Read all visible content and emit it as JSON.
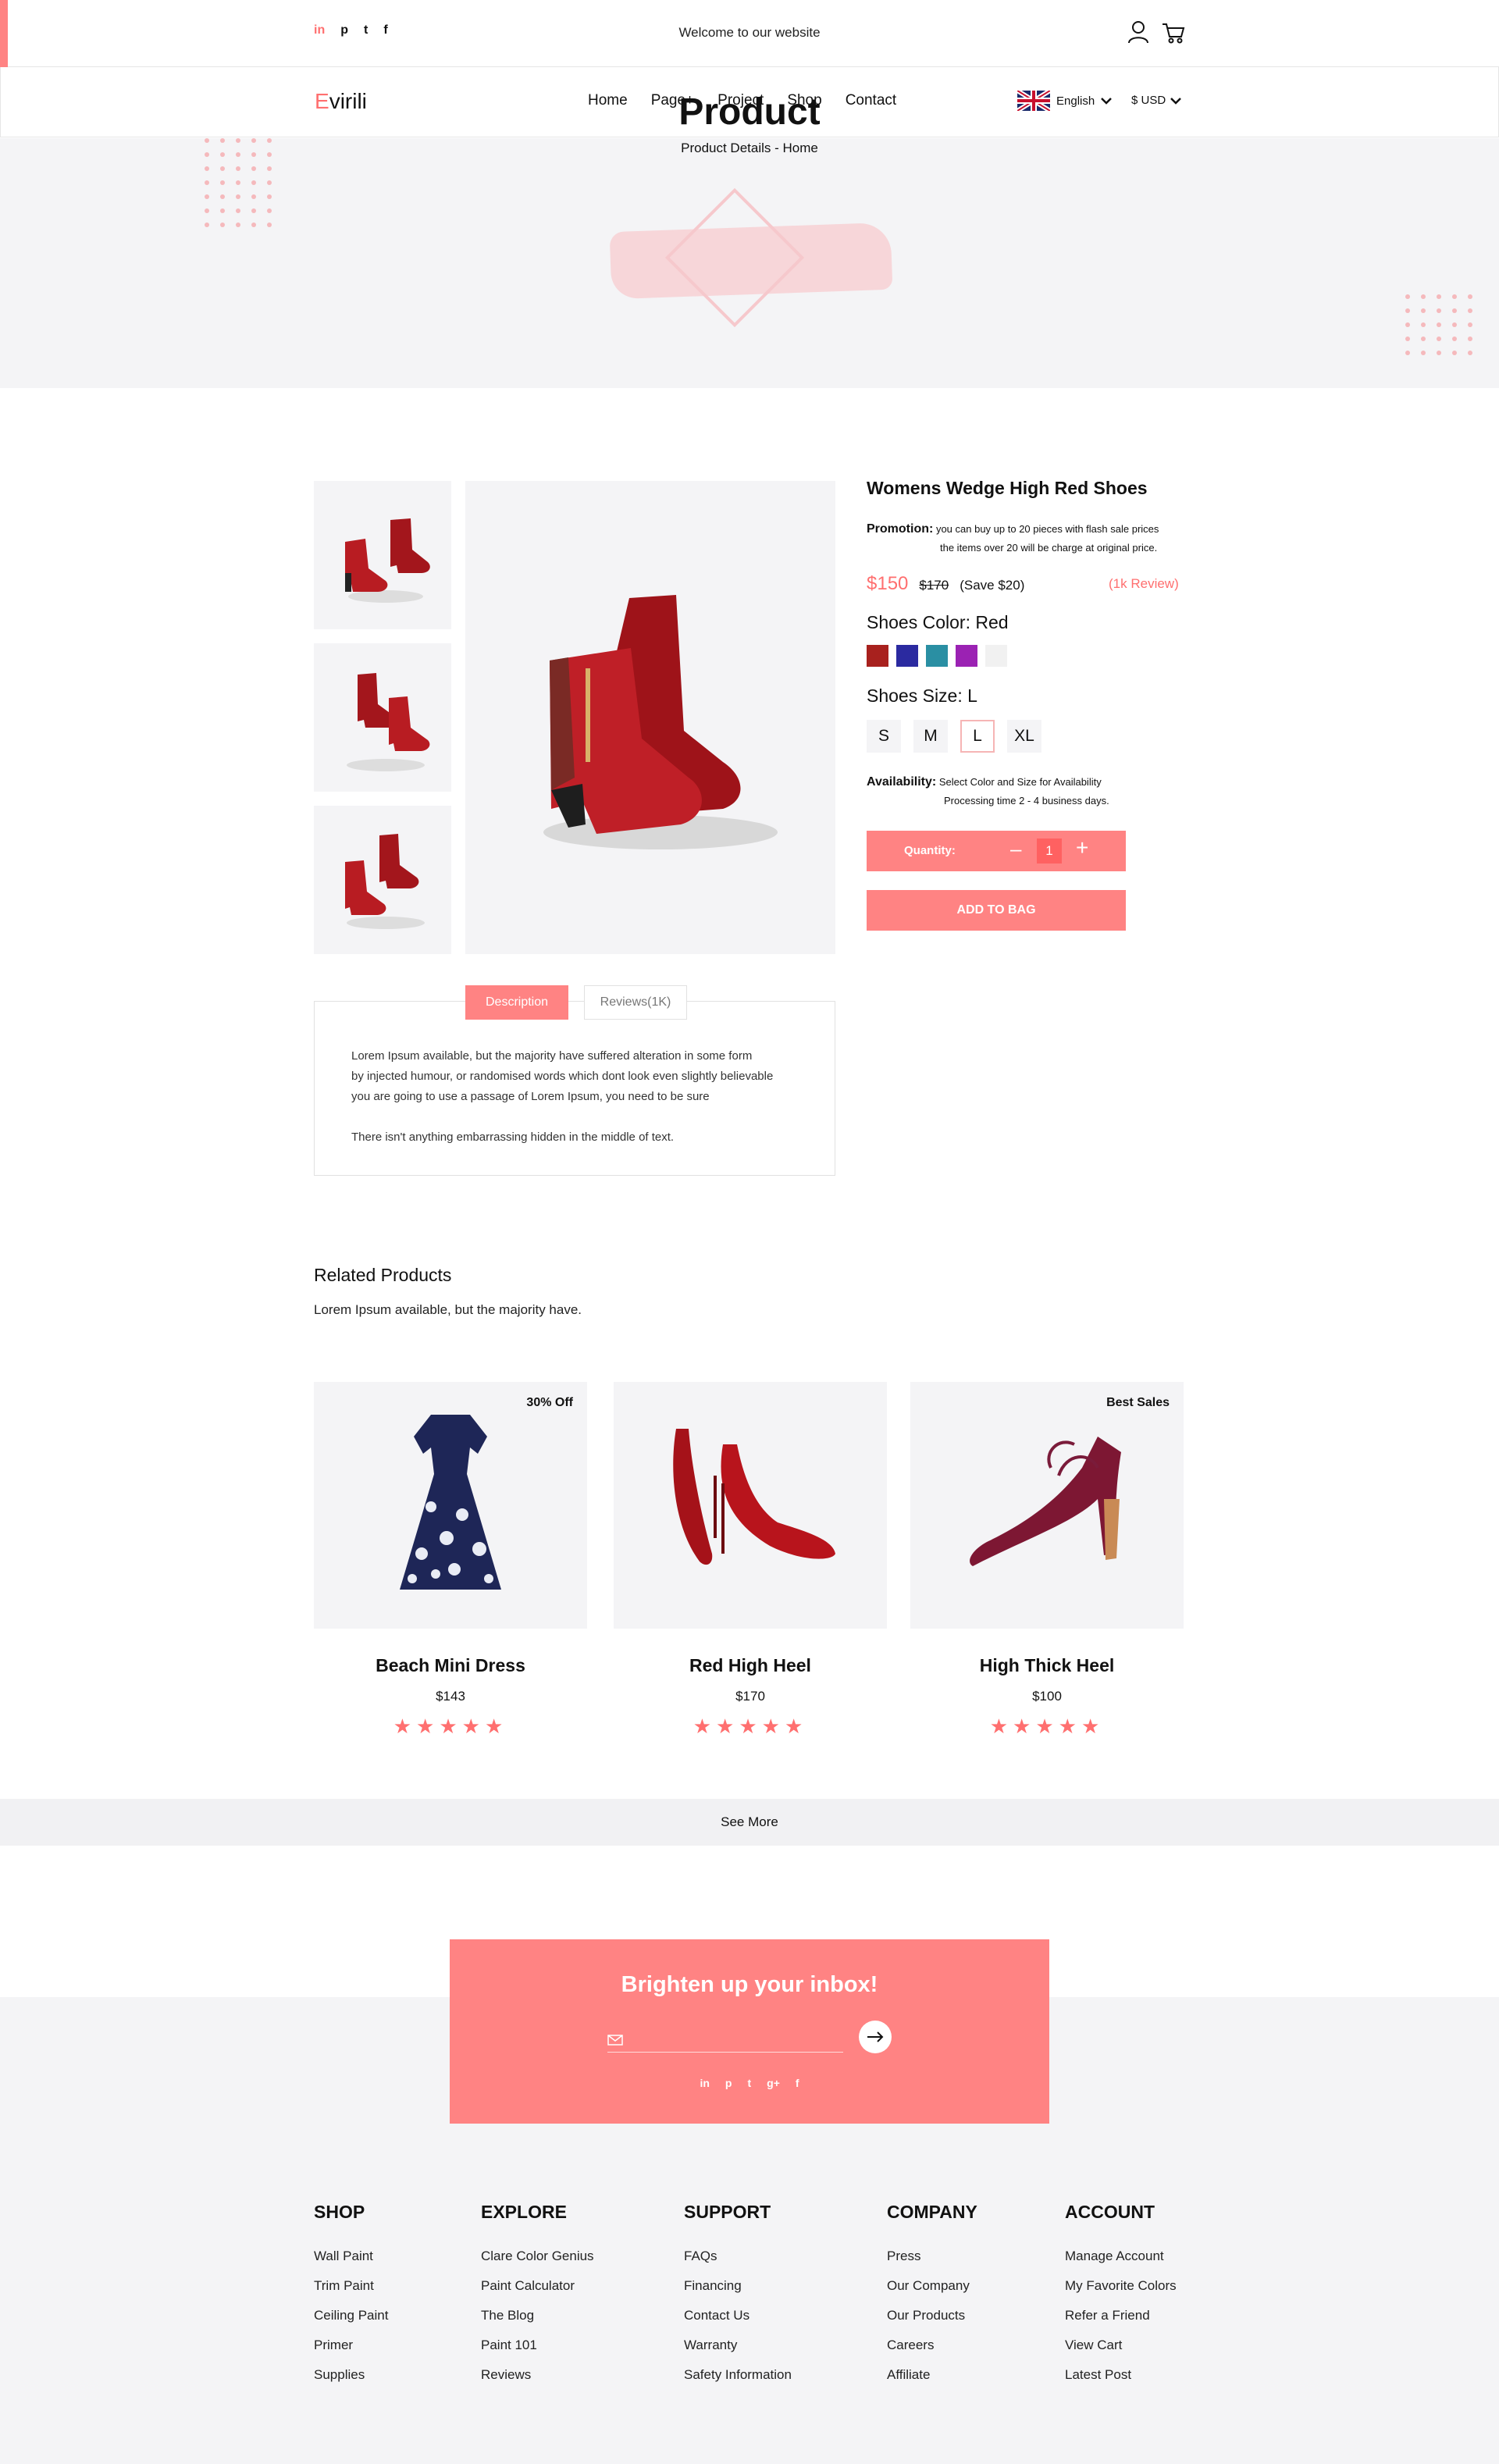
{
  "topbar": {
    "social": [
      "in",
      "p",
      "t",
      "f"
    ],
    "welcome": "Welcome to our website"
  },
  "nav": {
    "logo_first": "E",
    "logo_rest": "virili",
    "menu": [
      "Home",
      "Page+",
      "Project",
      "Shop",
      "Contact"
    ],
    "language": "English",
    "currency": "$ USD"
  },
  "hero": {
    "title": "Product",
    "breadcrumb": "Product Details - Home"
  },
  "product": {
    "title": "Womens  Wedge High Red  Shoes",
    "promo_label": "Promotion:",
    "promo_line1": "you can buy up to 20 pieces with flash sale prices",
    "promo_line2": "the items over 20 will be charge at original price.",
    "price": "$150",
    "old_price": "$170",
    "save": "(Save $20)",
    "review": "(1k Review)",
    "color_label": "Shoes Color: Red",
    "colors": [
      "#a8211e",
      "#2b2aa0",
      "#2a8fa3",
      "#9b22b3",
      "#f1f1f1"
    ],
    "size_label": "Shoes Size: L",
    "sizes": [
      "S",
      "M",
      "L",
      "XL"
    ],
    "selected_size": "L",
    "availability_label": "Availability:",
    "availability_line1": "Select Color and Size for Availability",
    "availability_line2": "Processing time 2 - 4 business days.",
    "quantity_label": "Quantity:",
    "quantity": "1",
    "add_to_bag": "ADD TO BAG"
  },
  "tabs": {
    "description": "Description",
    "reviews": "Reviews(1K)",
    "text1_line1": "Lorem Ipsum available, but the majority have suffered alteration in some form",
    "text1_line2": "by injected humour, or randomised words which dont look even slightly believable",
    "text1_line3": "you are going to use a passage of Lorem Ipsum, you need to be sure",
    "text2": "There isn't anything embarrassing hidden in the middle of text."
  },
  "related": {
    "title": "Related Products",
    "subtitle": "Lorem Ipsum available, but the majority have.",
    "items": [
      {
        "name": "Beach Mini Dress",
        "price": "$143",
        "badge": "30% Off",
        "rating": 5
      },
      {
        "name": "Red High Heel",
        "price": "$170",
        "badge": "",
        "rating": 5
      },
      {
        "name": "High Thick Heel",
        "price": "$100",
        "badge": "Best Sales",
        "rating": 5
      }
    ],
    "see_more": "See More"
  },
  "newsletter": {
    "title": "Brighten up your inbox!",
    "social": [
      "in",
      "p",
      "t",
      "g+",
      "f"
    ]
  },
  "footer": {
    "columns": [
      {
        "title": "SHOP",
        "links": [
          "Wall Paint",
          "Trim Paint",
          "Ceiling Paint",
          "Primer",
          "Supplies"
        ]
      },
      {
        "title": "EXPLORE",
        "links": [
          "Clare Color Genius",
          "Paint Calculator",
          "The Blog",
          "Paint 101",
          "Reviews"
        ]
      },
      {
        "title": "SUPPORT",
        "links": [
          "FAQs",
          "Financing",
          "Contact Us",
          "Warranty",
          "Safety Information"
        ]
      },
      {
        "title": "COMPANY",
        "links": [
          "Press",
          "Our Company",
          "Our Products",
          "Careers",
          "Affiliate"
        ]
      },
      {
        "title": "ACCOUNT",
        "links": [
          "Manage Account",
          "My Favorite Colors",
          "Refer a Friend",
          "View Cart",
          "Latest Post"
        ]
      }
    ]
  },
  "colors": {
    "accent": "#ff8383",
    "background_light": "#f4f4f6"
  }
}
